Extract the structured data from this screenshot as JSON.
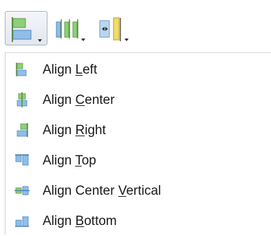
{
  "toolbar": {
    "buttons": [
      {
        "name": "align-left-dropdown",
        "icon": "align-left-icon",
        "active": true
      },
      {
        "name": "distribute-dropdown",
        "icon": "distribute-horizontal-icon",
        "active": false
      },
      {
        "name": "resize-dropdown",
        "icon": "make-same-width-icon",
        "active": false
      }
    ]
  },
  "menu": {
    "items": [
      {
        "pre": "Align ",
        "key": "L",
        "post": "eft",
        "icon": "align-left-icon"
      },
      {
        "pre": "Align ",
        "key": "C",
        "post": "enter",
        "icon": "align-center-icon"
      },
      {
        "pre": "Align ",
        "key": "R",
        "post": "ight",
        "icon": "align-right-icon"
      },
      {
        "pre": "Align ",
        "key": "T",
        "post": "op",
        "icon": "align-top-icon"
      },
      {
        "pre": "Align Center ",
        "key": "V",
        "post": "ertical",
        "icon": "align-center-vertical-icon"
      },
      {
        "pre": "Align ",
        "key": "B",
        "post": "ottom",
        "icon": "align-bottom-icon"
      }
    ]
  },
  "colors": {
    "icon_green": "#8fcf7a",
    "icon_blue": "#8fbfe8",
    "icon_yellow": "#f2dc6a",
    "menu_text": "#1a1a1a"
  }
}
